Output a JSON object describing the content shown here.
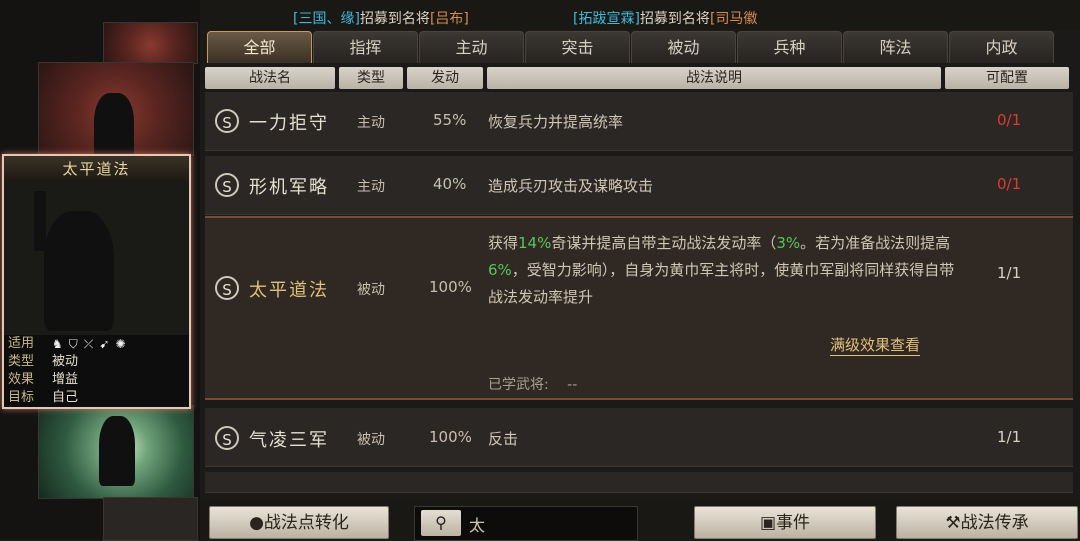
{
  "banner": {
    "msg1_general_tag": "[三国、缘]",
    "msg1_text": "招募到名将",
    "msg1_name": "[吕布]",
    "msg2_general_tag": "[拓跋宣霖]",
    "msg2_text": "招募到名将",
    "msg2_name": "[司马徽"
  },
  "tabs": [
    "全部",
    "指挥",
    "主动",
    "突击",
    "被动",
    "兵种",
    "阵法",
    "内政"
  ],
  "active_tab": 0,
  "columns": {
    "name": "战法名",
    "type": "类型",
    "rate": "发动",
    "desc": "战法说明",
    "config": "可配置"
  },
  "rows": [
    {
      "grade": "S",
      "name": "一力拒守",
      "type": "主动",
      "rate": "55%",
      "desc": "恢复兵力并提高统率",
      "config": "0/1",
      "config_color": "red"
    },
    {
      "grade": "S",
      "name": "形机军略",
      "type": "主动",
      "rate": "40%",
      "desc": "造成兵刃攻击及谋略攻击",
      "config": "0/1",
      "config_color": "red"
    },
    {
      "grade": "S",
      "name": "太平道法",
      "type": "被动",
      "rate": "100%",
      "config": "1/1",
      "config_color": "white",
      "desc_parts": [
        "获得",
        "14%",
        "奇谋并提高自带主动战法发动率（",
        "3%",
        "。若为准备战法则提高",
        "6%",
        "，受智力影响），自身为黄巾军主将时，使黄巾军副将同样获得自带战法发动率提升"
      ],
      "full_effect_link": "满级效果查看",
      "learned_label": "已学武将:",
      "learned_value": "--"
    },
    {
      "grade": "S",
      "name": "气凌三军",
      "type": "被动",
      "rate": "100%",
      "desc": "反击",
      "config": "1/1",
      "config_color": "white"
    }
  ],
  "selected_card": {
    "title": "太平道法",
    "adapt_label": "适用",
    "adapt_icons": [
      "cavalry-icon",
      "shield-icon",
      "archer-icon",
      "spear-icon",
      "siege-icon"
    ],
    "type_label": "类型",
    "type_value": "被动",
    "effect_label": "效果",
    "effect_value": "增益",
    "target_label": "目标",
    "target_value": "自己"
  },
  "bottom": {
    "convert_button": "战法点转化",
    "search_value": "太",
    "event_button": "事件",
    "inherit_button": "战法传承"
  },
  "colors": {
    "highlight_green": "#59c45a",
    "config_red": "#e03a2f",
    "gold_text": "#e0c07a",
    "banner_blue": "#43b8d8",
    "banner_orange": "#d68b56"
  }
}
